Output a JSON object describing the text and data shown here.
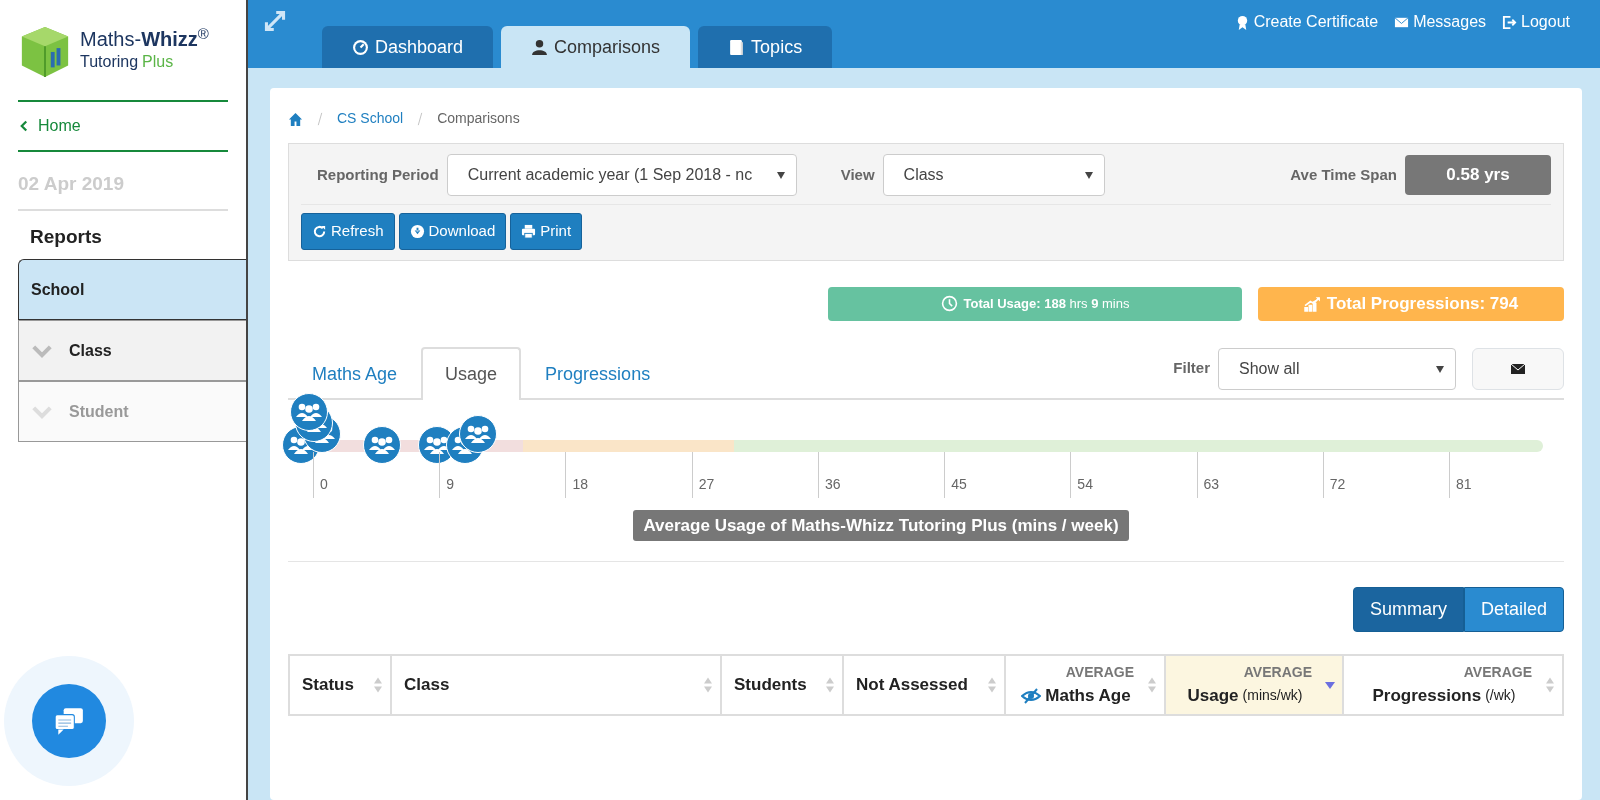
{
  "sidebar": {
    "logo": {
      "title": "Maths-**Whizz**$^{®}$",
      "subtitle_part1": "Tutoring",
      "subtitle_part2": "Plus"
    },
    "home_link": "Home",
    "date": "02 Apr 2019",
    "heading": "Reports",
    "report_items": [
      {
        "label": "School",
        "selected": true,
        "expandable": false,
        "disabled": false
      },
      {
        "label": "Class",
        "selected": false,
        "expandable": true,
        "disabled": false
      },
      {
        "label": "Student",
        "selected": false,
        "expandable": true,
        "disabled": true
      }
    ]
  },
  "top_tabs": [
    {
      "label": "Dashboard",
      "kind": "dashboard",
      "selected": false
    },
    {
      "label": "Comparisons",
      "kind": "user",
      "selected": true
    },
    {
      "label": "Topics",
      "kind": "book",
      "selected": false
    }
  ],
  "top_links": [
    {
      "label": "Create Certificate",
      "kind": "certificate"
    },
    {
      "label": "Messages",
      "kind": "mail"
    },
    {
      "label": "Logout",
      "kind": "logout"
    }
  ],
  "breadcrumb": [
    {
      "label": "CS School",
      "current": false
    },
    {
      "label": "Comparisons",
      "current": true
    }
  ],
  "controls": {
    "reporting_period": {
      "label": "Reporting Period",
      "value": "Current academic year (1 Sep 2018 - nc"
    },
    "view": {
      "label": "View",
      "value": "Class"
    },
    "ave_time_span": {
      "label": "Ave Time Span",
      "value": "0.58 yrs"
    },
    "buttons": [
      {
        "label": "Refresh",
        "kind": "refresh"
      },
      {
        "label": "Download",
        "kind": "download"
      },
      {
        "label": "Print",
        "kind": "print"
      }
    ]
  },
  "totals": [
    {
      "kind": "usage",
      "text": "**Total Usage: 188** hrs **9** mins",
      "color": "#66c2a0"
    },
    {
      "kind": "progressions",
      "text": "Total Progressions: 794",
      "color": "#ffb54d"
    }
  ],
  "metric_tabs": [
    {
      "label": "Maths Age",
      "selected": false
    },
    {
      "label": "Usage",
      "selected": true
    },
    {
      "label": "Progressions",
      "selected": false
    }
  ],
  "filter": {
    "label": "Filter",
    "value": "Show all"
  },
  "usage_scale": {
    "zones": [
      {
        "color": "#f2dede"
      },
      {
        "color": "#fae5c8"
      },
      {
        "color": "#dff0d8"
      }
    ],
    "markers": [
      {
        "level": 0.01
      },
      {
        "level": 0.027
      },
      {
        "level": 0.021
      },
      {
        "level": 0.017
      },
      {
        "level": 0.075
      },
      {
        "level": 0.119
      },
      {
        "level": 0.141
      },
      {
        "level": 0.151
      }
    ],
    "ticks": [
      "0",
      "9",
      "18",
      "27",
      "36",
      "45",
      "54",
      "63",
      "72",
      "81"
    ],
    "title": "Average Usage of Maths-Whizz Tutoring Plus (mins / week)"
  },
  "view_toggle": [
    {
      "label": "Summary",
      "selected": true
    },
    {
      "label": "Detailed",
      "selected": false
    }
  ],
  "table": {
    "columns": [
      {
        "kind": "plain",
        "label": "Status",
        "sorted": false,
        "highlighted": false
      },
      {
        "kind": "plain",
        "label": "Class",
        "sorted": false,
        "highlighted": false
      },
      {
        "kind": "plain",
        "label": "Students",
        "sorted": false,
        "highlighted": false
      },
      {
        "kind": "plain",
        "label": "Not Assessed",
        "sorted": false,
        "highlighted": false
      },
      {
        "kind": "average_hidden",
        "overline": "AVERAGE",
        "label": "Maths Age",
        "sorted": false,
        "highlighted": false
      },
      {
        "kind": "average",
        "overline": "AVERAGE",
        "label": "Usage",
        "unit": "(mins/wk)",
        "sorted": true,
        "highlighted": true
      },
      {
        "kind": "average",
        "overline": "AVERAGE",
        "label": "Progressions",
        "unit": "(/wk)",
        "sorted": false,
        "highlighted": false
      }
    ]
  }
}
